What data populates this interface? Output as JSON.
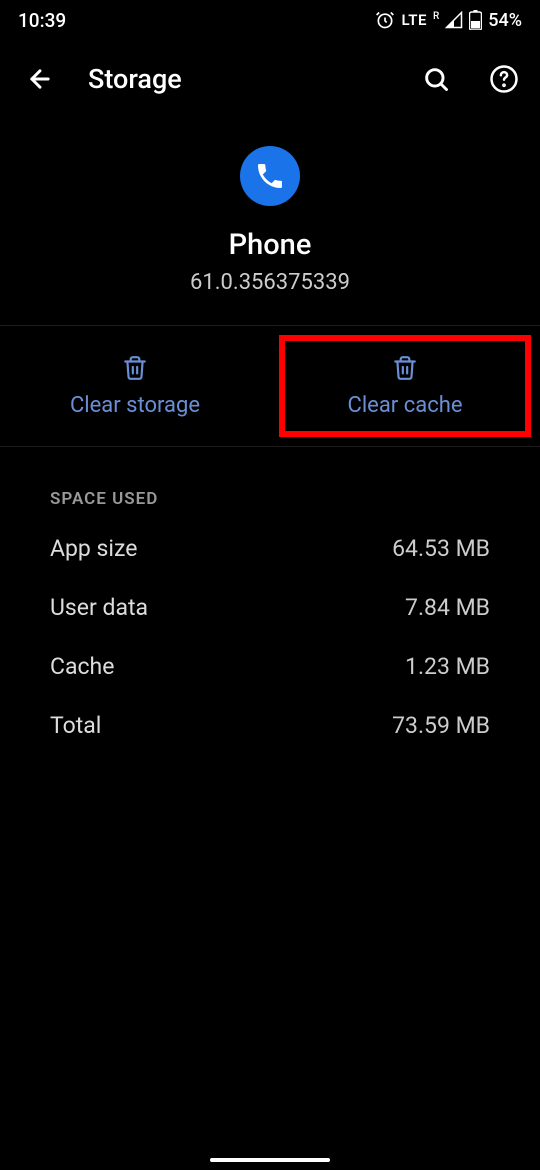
{
  "status": {
    "time": "10:39",
    "lte": "LTE",
    "r": "R",
    "battery": "54%"
  },
  "toolbar": {
    "title": "Storage"
  },
  "app": {
    "name": "Phone",
    "version": "61.0.356375339"
  },
  "actions": {
    "clear_storage": "Clear storage",
    "clear_cache": "Clear cache"
  },
  "space": {
    "header": "Space used",
    "rows": [
      {
        "label": "App size",
        "value": "64.53 MB"
      },
      {
        "label": "User data",
        "value": "7.84 MB"
      },
      {
        "label": "Cache",
        "value": "1.23 MB"
      },
      {
        "label": "Total",
        "value": "73.59 MB"
      }
    ]
  }
}
